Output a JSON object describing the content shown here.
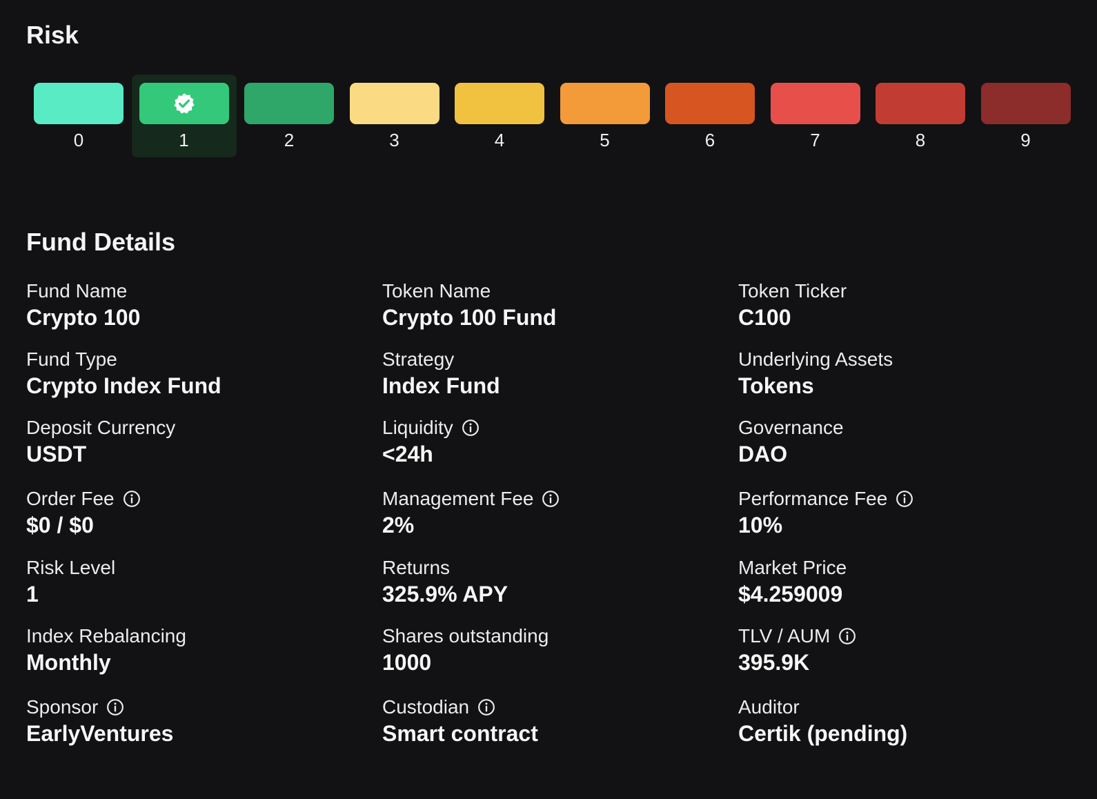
{
  "risk": {
    "title": "Risk",
    "selected_level": 1,
    "levels": [
      {
        "label": "0",
        "color": "#58ebc4"
      },
      {
        "label": "1",
        "color": "#34c97a"
      },
      {
        "label": "2",
        "color": "#2ea768"
      },
      {
        "label": "3",
        "color": "#fadb84"
      },
      {
        "label": "4",
        "color": "#f1c23f"
      },
      {
        "label": "5",
        "color": "#f29b38"
      },
      {
        "label": "6",
        "color": "#d75520"
      },
      {
        "label": "7",
        "color": "#e7504a"
      },
      {
        "label": "8",
        "color": "#c13d33"
      },
      {
        "label": "9",
        "color": "#8c2c2b"
      }
    ],
    "selected_icon": "verified-check-icon"
  },
  "fund_details": {
    "title": "Fund Details",
    "fields": [
      {
        "label": "Fund Name",
        "value": "Crypto 100",
        "info": false
      },
      {
        "label": "Token Name",
        "value": "Crypto 100 Fund",
        "info": false
      },
      {
        "label": "Token Ticker",
        "value": "C100",
        "info": false
      },
      {
        "label": "Fund Type",
        "value": "Crypto Index Fund",
        "info": false
      },
      {
        "label": "Strategy",
        "value": "Index Fund",
        "info": false
      },
      {
        "label": "Underlying Assets",
        "value": "Tokens",
        "info": false
      },
      {
        "label": "Deposit Currency",
        "value": "USDT",
        "info": false
      },
      {
        "label": "Liquidity",
        "value": "<24h",
        "info": true
      },
      {
        "label": "Governance",
        "value": "DAO",
        "info": false
      },
      {
        "label": "Order Fee",
        "value": "$0 / $0",
        "info": true
      },
      {
        "label": "Management Fee",
        "value": "2%",
        "info": true
      },
      {
        "label": "Performance Fee",
        "value": "10%",
        "info": true
      },
      {
        "label": "Risk Level",
        "value": "1",
        "info": false
      },
      {
        "label": "Returns",
        "value": "325.9% APY",
        "info": false
      },
      {
        "label": "Market Price",
        "value": "$4.259009",
        "info": false
      },
      {
        "label": "Index Rebalancing",
        "value": "Monthly",
        "info": false
      },
      {
        "label": "Shares outstanding",
        "value": "1000",
        "info": false
      },
      {
        "label": "TLV / AUM",
        "value": "395.9K",
        "info": true
      },
      {
        "label": "Sponsor",
        "value": "EarlyVentures",
        "info": true
      },
      {
        "label": "Custodian",
        "value": "Smart contract",
        "info": true
      },
      {
        "label": "Auditor",
        "value": "Certik (pending)",
        "info": false
      }
    ],
    "info_icon": "info-circle-icon"
  }
}
